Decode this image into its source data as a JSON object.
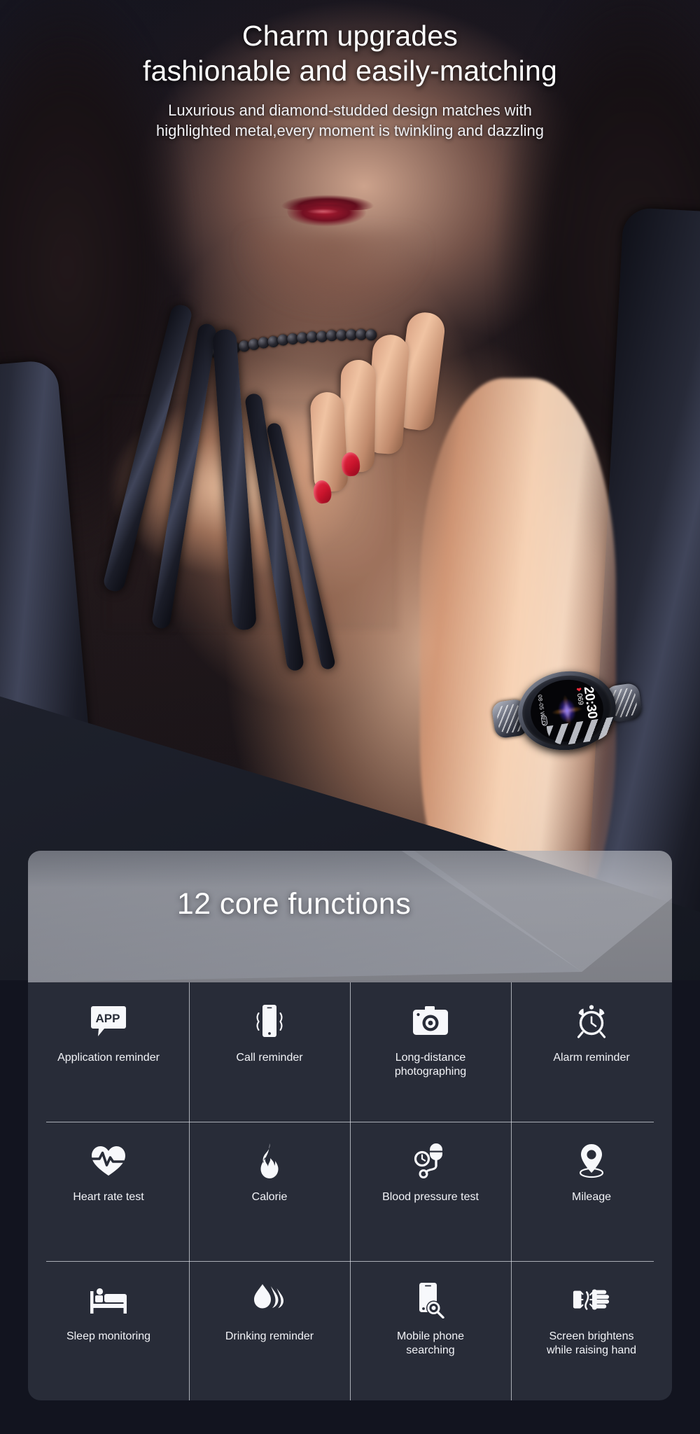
{
  "header": {
    "title_line1": "Charm upgrades",
    "title_line2": "fashionable and easily-matching",
    "subtitle_line1": "Luxurious and diamond-studded design matches with",
    "subtitle_line2": "highlighted metal,every moment is twinkling and dazzling"
  },
  "watch": {
    "time": "20:30",
    "heart_rate": "069",
    "date": "08-05 WED",
    "heart_icon": "heart-icon"
  },
  "banner": {
    "title": "12 core functions"
  },
  "features": {
    "count": 12,
    "items": [
      {
        "label": "Application reminder",
        "icon": "app-bubble-icon"
      },
      {
        "label": "Call reminder",
        "icon": "phone-vibrate-icon"
      },
      {
        "label": "Long-distance\nphotographing",
        "icon": "camera-icon"
      },
      {
        "label": "Alarm reminder",
        "icon": "alarm-clock-icon"
      },
      {
        "label": "Heart rate test",
        "icon": "heart-pulse-icon"
      },
      {
        "label": "Calorie",
        "icon": "flame-icon"
      },
      {
        "label": "Blood pressure test",
        "icon": "blood-pressure-icon"
      },
      {
        "label": "Mileage",
        "icon": "location-pin-icon"
      },
      {
        "label": "Sleep monitoring",
        "icon": "bed-icon"
      },
      {
        "label": "Drinking reminder",
        "icon": "water-drops-icon"
      },
      {
        "label": "Mobile phone\nsearching",
        "icon": "phone-search-icon"
      },
      {
        "label": "Screen brightens\nwhile raising hand",
        "icon": "raise-hand-icon"
      }
    ]
  },
  "colors": {
    "page_background": "#12141f",
    "panel_background": "#282c38",
    "divider": "#dee0e8",
    "text_primary": "#ffffff",
    "accent_red": "#ef2b3c",
    "nail_red": "#c8142c",
    "lips_red": "#8a1428"
  }
}
